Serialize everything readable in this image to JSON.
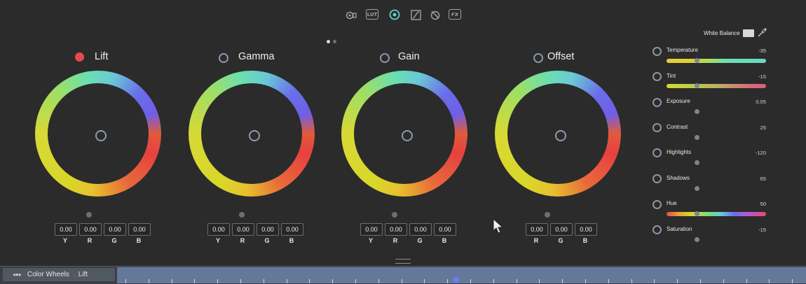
{
  "toolbar": {
    "icons": [
      "camera-icon",
      "lut-icon",
      "color-wheels-icon",
      "curves-icon",
      "eyedropper-tool-icon",
      "fx-icon"
    ],
    "lut_label": "LUT",
    "fx_label": "FX",
    "active_icon": "color-wheels-icon"
  },
  "page_indicator": {
    "count": 2,
    "active": 1
  },
  "wheels": [
    {
      "title": "Lift",
      "active": true,
      "values": [
        "0.00",
        "0.00",
        "0.00",
        "0.00"
      ],
      "channels": [
        "Y",
        "R",
        "G",
        "B"
      ]
    },
    {
      "title": "Gamma",
      "active": false,
      "values": [
        "0.00",
        "0.00",
        "0.00",
        "0.00"
      ],
      "channels": [
        "Y",
        "R",
        "G",
        "B"
      ]
    },
    {
      "title": "Gain",
      "active": false,
      "values": [
        "0.00",
        "0.00",
        "0.00",
        "0.00"
      ],
      "channels": [
        "Y",
        "R",
        "G",
        "B"
      ]
    },
    {
      "title": "Offset",
      "active": false,
      "values": [
        "0.00",
        "0.00",
        "0.00"
      ],
      "channels": [
        "R",
        "G",
        "B"
      ]
    }
  ],
  "white_balance": {
    "label": "White Balance"
  },
  "adjustments": [
    {
      "label": "Temperature",
      "value": "-35",
      "bar": "temperature",
      "level": 0.3
    },
    {
      "label": "Tint",
      "value": "-15",
      "bar": "tint",
      "level": 0.3
    },
    {
      "label": "Exposure",
      "value": "0.05",
      "bar": null,
      "level": 0.3
    },
    {
      "label": "Contrast",
      "value": "25",
      "bar": null,
      "level": 0.3
    },
    {
      "label": "Highlights",
      "value": "-120",
      "bar": null,
      "level": 0.3
    },
    {
      "label": "Shadows",
      "value": "65",
      "bar": null,
      "level": 0.3
    },
    {
      "label": "Hue",
      "value": "50",
      "bar": "hue",
      "level": 0.3
    },
    {
      "label": "Saturation",
      "value": "-15",
      "bar": null,
      "level": 0.3
    }
  ],
  "timeline": {
    "label": "Color Wheels",
    "sublabel": "Lift"
  },
  "colors": {
    "background": "#2b2b2b",
    "accent": "#5fd0c8",
    "active_dot": "#e84a4a",
    "timeline": "#66789a"
  }
}
